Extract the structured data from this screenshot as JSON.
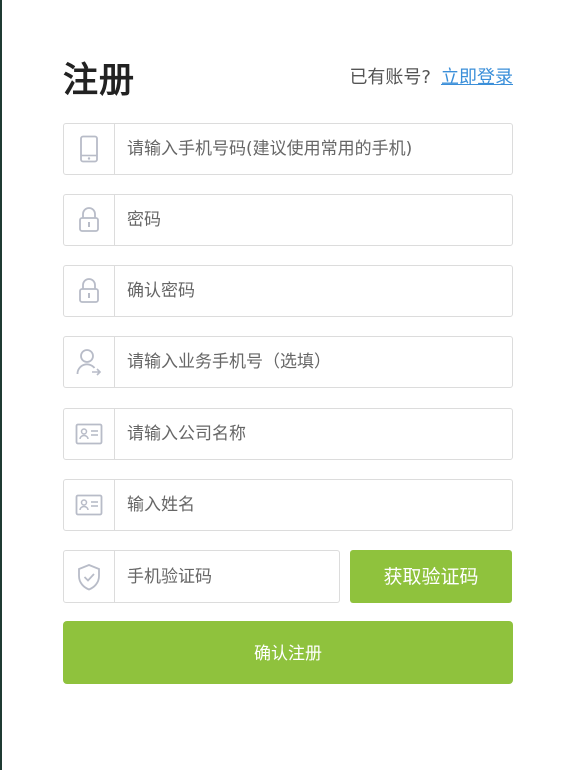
{
  "header": {
    "title": "注册",
    "login_prompt": "已有账号?",
    "login_link": "立即登录"
  },
  "form": {
    "phone": {
      "placeholder": "请输入手机号码(建议使用常用的手机)",
      "icon": "phone-icon"
    },
    "password": {
      "placeholder": "密码",
      "icon": "lock-icon"
    },
    "confirm_password": {
      "placeholder": "确认密码",
      "icon": "lock-icon"
    },
    "business_phone": {
      "placeholder": "请输入业务手机号（选填）",
      "icon": "user-arrow-icon"
    },
    "company": {
      "placeholder": "请输入公司名称",
      "icon": "id-card-icon"
    },
    "name": {
      "placeholder": "输入姓名",
      "icon": "id-card-icon"
    },
    "sms_code": {
      "placeholder": "手机验证码",
      "icon": "shield-check-icon"
    },
    "get_code_button": "获取验证码",
    "submit_button": "确认注册"
  },
  "colors": {
    "accent": "#8fc23d",
    "link": "#3b8fd9",
    "border": "#dcdcdc",
    "icon": "#b8bcc8"
  }
}
